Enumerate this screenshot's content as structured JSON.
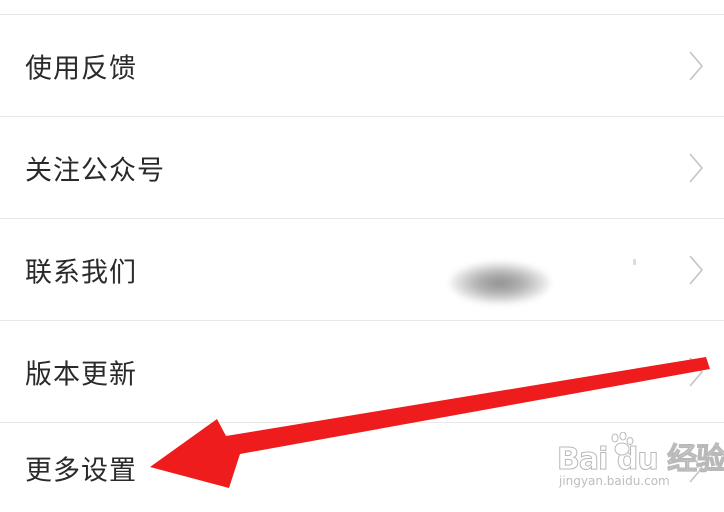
{
  "settings": {
    "items": [
      {
        "label": "使用反馈",
        "icon": "chevron-right-icon"
      },
      {
        "label": "关注公众号",
        "icon": "chevron-right-icon"
      },
      {
        "label": "联系我们",
        "icon": "chevron-right-icon"
      },
      {
        "label": "版本更新",
        "icon": "chevron-right-icon"
      },
      {
        "label": "更多设置",
        "icon": "chevron-right-icon"
      }
    ]
  },
  "annotation": {
    "arrow_color": "#ee1c1c",
    "arrow_icon": "red-arrow-annotation"
  },
  "watermark": {
    "brand": "Bai du 经验",
    "url": "jingyan.baidu.com"
  },
  "colors": {
    "background": "#ffffff",
    "divider": "#e8e8e8",
    "text": "#2a2a2a",
    "chevron": "#c4c4c4"
  }
}
